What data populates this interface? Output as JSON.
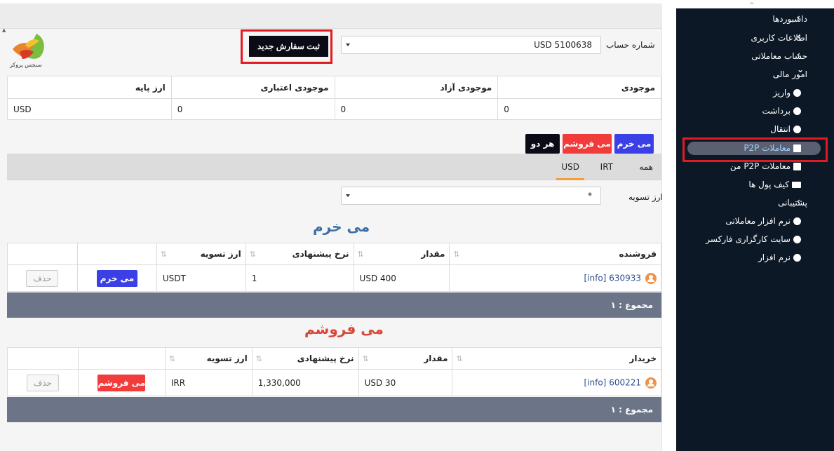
{
  "main": {
    "logo_text": "سنجس پروکر",
    "new_order_button": "ثبت سفارش جدید",
    "account_label": "شماره حساب",
    "account_value": "USD 5100638",
    "balance": {
      "headers": [
        "موجودی",
        "موجودی آزاد",
        "موجودی اعتباری",
        "ارز پایه"
      ],
      "values": [
        "0",
        "0",
        "0",
        "USD"
      ]
    },
    "type_buttons": {
      "buy": "می خرم",
      "sell": "می فروشم",
      "both": "هر دو"
    },
    "tabs": [
      "همه",
      "IRT",
      "USD"
    ],
    "settlement_label": "ارز تسویه",
    "settlement_value": "*",
    "buy_section": {
      "title": "می خرم",
      "headers": [
        "فروشنده",
        "مقدار",
        "نرخ پیشنهادی",
        "ارز تسویه"
      ],
      "row": {
        "user": "630933",
        "info": "[info]",
        "amount": "400 USD",
        "rate": "1",
        "currency": "USDT",
        "action": "می خرم",
        "delete": "حذف"
      },
      "total": "مجموع : ۱"
    },
    "sell_section": {
      "title": "می فروشم",
      "headers": [
        "خریدار",
        "مقدار",
        "نرخ پیشنهادی",
        "ارز تسویه"
      ],
      "row": {
        "user": "600221",
        "info": "[info]",
        "amount": "30 USD",
        "rate": "1,330,000",
        "currency": "IRR",
        "action": "می فروشم",
        "delete": "حذف"
      },
      "total": "مجموع : ۱"
    }
  },
  "sidebar": {
    "items": [
      {
        "label": "داشبوردها",
        "chevron": "‹"
      },
      {
        "label": "اطلاعات کاربری",
        "chevron": "‹"
      },
      {
        "label": "حساب معاملاتی",
        "chevron": "‹"
      },
      {
        "label": "امور مالی",
        "chevron": "⌄"
      }
    ],
    "finance_sub": [
      "واریز",
      "برداشت",
      "انتقال",
      "معاملات P2P",
      "معاملات P2P من",
      "کیف پول ها"
    ],
    "support": {
      "label": "پشتیبانی",
      "chevron": "‹"
    },
    "support_sub": [
      "نرم افزار معاملاتی",
      "سایت کارگزاری فارکسر",
      "نرم افزار"
    ]
  },
  "colors": {
    "buy_blue": "#3a3fe6",
    "sell_red": "#f23b3b",
    "buy_title": "#3b6fa6",
    "sell_title": "#d9463a",
    "sidebar_bg": "#0c1826",
    "highlight_frame": "#e21b23"
  }
}
